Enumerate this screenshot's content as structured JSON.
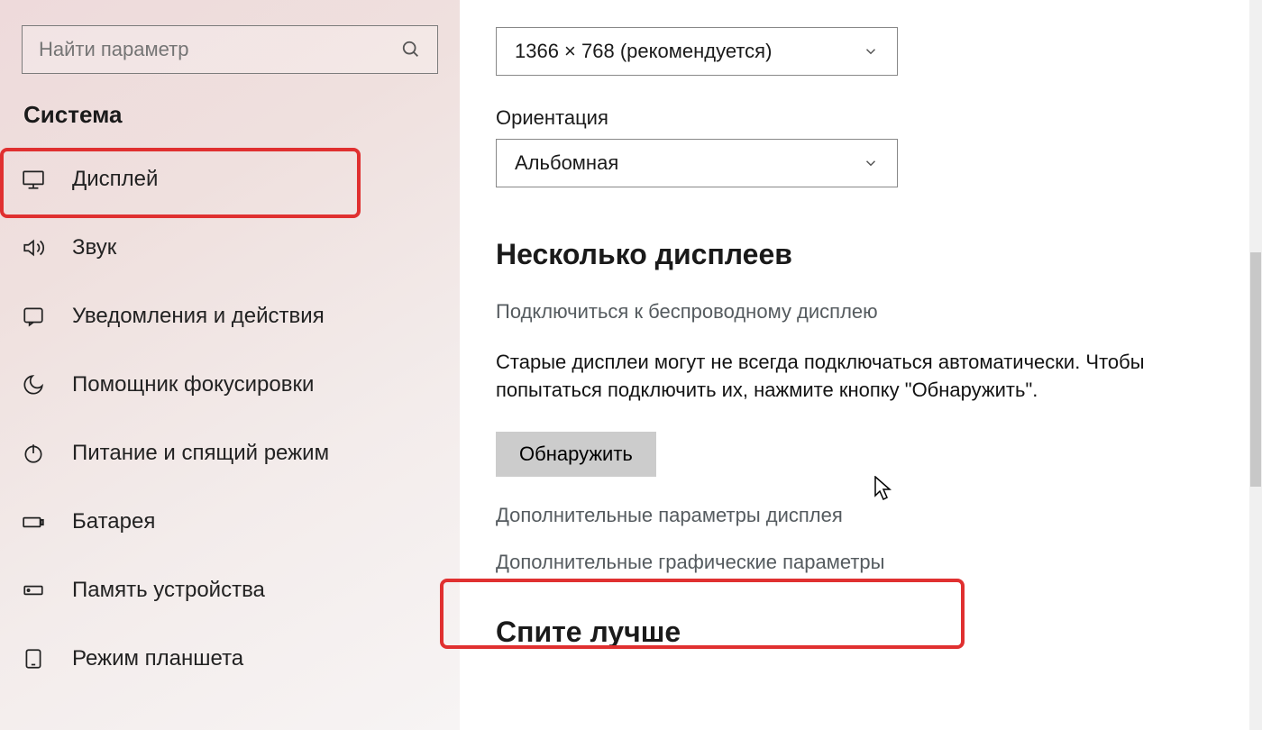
{
  "sidebar": {
    "search_placeholder": "Найти параметр",
    "category": "Система",
    "items": [
      {
        "label": "Дисплей",
        "icon": "monitor-icon"
      },
      {
        "label": "Звук",
        "icon": "sound-icon"
      },
      {
        "label": "Уведомления и действия",
        "icon": "notification-icon"
      },
      {
        "label": "Помощник фокусировки",
        "icon": "moon-icon"
      },
      {
        "label": "Питание и спящий режим",
        "icon": "power-icon"
      },
      {
        "label": "Батарея",
        "icon": "battery-icon"
      },
      {
        "label": "Память устройства",
        "icon": "storage-icon"
      },
      {
        "label": "Режим планшета",
        "icon": "tablet-icon"
      }
    ]
  },
  "main": {
    "resolution_value": "1366 × 768 (рекомендуется)",
    "orientation_label": "Ориентация",
    "orientation_value": "Альбомная",
    "multi_heading": "Несколько дисплеев",
    "wireless_link": "Подключиться к беспроводному дисплею",
    "detect_paragraph": "Старые дисплеи могут не всегда подключаться автоматически. Чтобы попытаться подключить их, нажмите кнопку \"Обнаружить\".",
    "detect_button": "Обнаружить",
    "adv_display_link": "Дополнительные параметры дисплея",
    "adv_graphics_link": "Дополнительные графические параметры",
    "sleep_heading": "Спите лучше"
  }
}
